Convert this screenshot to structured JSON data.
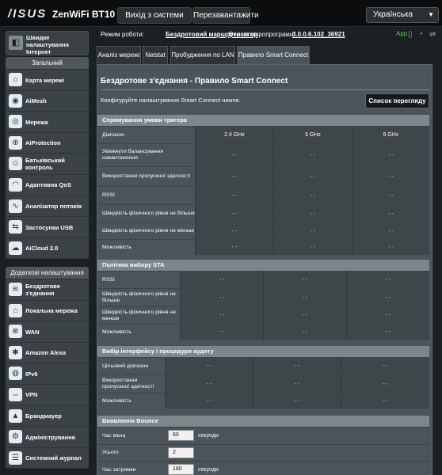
{
  "header": {
    "logo": "/ISUS",
    "model": "ZenWiFi BT10",
    "logout_label": "Вихід з системи",
    "reboot_label": "Перезавантажити",
    "language": "Українська"
  },
  "status": {
    "mode_label": "Режим роботи:",
    "mode_value": "Бездротовий маршрутизатор",
    "firmware_label": "Версія мікропрограми:",
    "firmware_value": "3.0.0.6.102_36921",
    "app_label": "App"
  },
  "sidebar": {
    "quick_setup": "Швидке налаштування Інтернет",
    "general_header": "Загальний",
    "general_items": [
      {
        "label": "Карта мережі",
        "icon": "network-map-icon"
      },
      {
        "label": "AiMesh",
        "icon": "aimesh-icon"
      },
      {
        "label": "Мережа",
        "icon": "network-icon"
      },
      {
        "label": "AiProtection",
        "icon": "aiprotection-icon"
      },
      {
        "label": "Батьківський контроль",
        "icon": "parental-control-icon"
      },
      {
        "label": "Адаптивна QoS",
        "icon": "qos-icon"
      },
      {
        "label": "Аналізатор потоків",
        "icon": "traffic-analyzer-icon"
      },
      {
        "label": "Застосунки USB",
        "icon": "usb-icon"
      },
      {
        "label": "AiCloud 2.0",
        "icon": "aicloud-icon"
      }
    ],
    "advanced_header": "Додаткові налаштування",
    "advanced_items": [
      {
        "label": "Бездротове з'єднання",
        "icon": "wireless-icon"
      },
      {
        "label": "Локальна мережа",
        "icon": "lan-icon"
      },
      {
        "label": "WAN",
        "icon": "wan-icon"
      },
      {
        "label": "Amazon Alexa",
        "icon": "alexa-icon"
      },
      {
        "label": "IPv6",
        "icon": "ipv6-icon"
      },
      {
        "label": "VPN",
        "icon": "vpn-icon"
      },
      {
        "label": "Брандмауер",
        "icon": "firewall-icon"
      },
      {
        "label": "Адміністрування",
        "icon": "admin-icon"
      },
      {
        "label": "Системний журнал",
        "icon": "syslog-icon"
      }
    ]
  },
  "tabs": [
    {
      "label": "Аналіз мережі"
    },
    {
      "label": "Netstat"
    },
    {
      "label": "Пробудження по LAN"
    },
    {
      "label": "Правило Smart Connect"
    }
  ],
  "main": {
    "title": "Бездротове з'єднання - Правило Smart Connect",
    "description": "Конфігуруйте налаштування Smart Connect нижче.",
    "list_button": "Список перегляду",
    "steering": {
      "header": "Спрямування умови тригера",
      "col_label": "Діапазон",
      "columns": [
        "2.4 GHz",
        "5 GHz",
        "6 GHz"
      ],
      "rows": [
        {
          "label": "Увімкнути балансування навантаження",
          "values": [
            "- -",
            "- -",
            "- -"
          ]
        },
        {
          "label": "Використання пропускної здатності",
          "values": [
            "- -",
            "- -",
            "- -"
          ]
        },
        {
          "label": "RSSI",
          "values": [
            "- -",
            "- -",
            "- -"
          ]
        },
        {
          "label": "Швидкість фізичного рівня не більше",
          "values": [
            "- -",
            "- -",
            "- -"
          ]
        },
        {
          "label": "Швидкість фізичного рівня не менше",
          "values": [
            "- -",
            "- -",
            "- -"
          ]
        },
        {
          "label": "Можливість",
          "values": [
            "- -",
            "- -",
            "- -"
          ]
        }
      ]
    },
    "sta": {
      "header": "Політика вибору STA",
      "rows": [
        {
          "label": "RSSI",
          "values": [
            "- -",
            "- -",
            "- -"
          ]
        },
        {
          "label": "Швидкість фізичного рівня не більше",
          "values": [
            "- -",
            "- -",
            "- -"
          ]
        },
        {
          "label": "Швидкість фізичного рівня не менше",
          "values": [
            "- -",
            "- -",
            "- -"
          ]
        },
        {
          "label": "Можливість",
          "values": [
            "- -",
            "- -",
            "- -"
          ]
        }
      ]
    },
    "interface": {
      "header": "Вибір інтерфейсу і процедури аудиту",
      "rows": [
        {
          "label": "Цільовий діапазон",
          "values": [
            "- -",
            "- -",
            "- -"
          ]
        },
        {
          "label": "Використання пропускної здатності",
          "values": [
            "- -",
            "- -",
            "- -"
          ]
        },
        {
          "label": "Можливість",
          "values": [
            "- -",
            "- -",
            "- -"
          ]
        }
      ]
    },
    "bounce": {
      "header": "Виявлення Bounce",
      "rows": [
        {
          "label": "Час вікна",
          "value": "60",
          "unit": "секунди"
        },
        {
          "label": "Усього",
          "value": "2",
          "unit": ""
        },
        {
          "label": "Час затримки",
          "value": "180",
          "unit": "секунди"
        }
      ]
    }
  }
}
